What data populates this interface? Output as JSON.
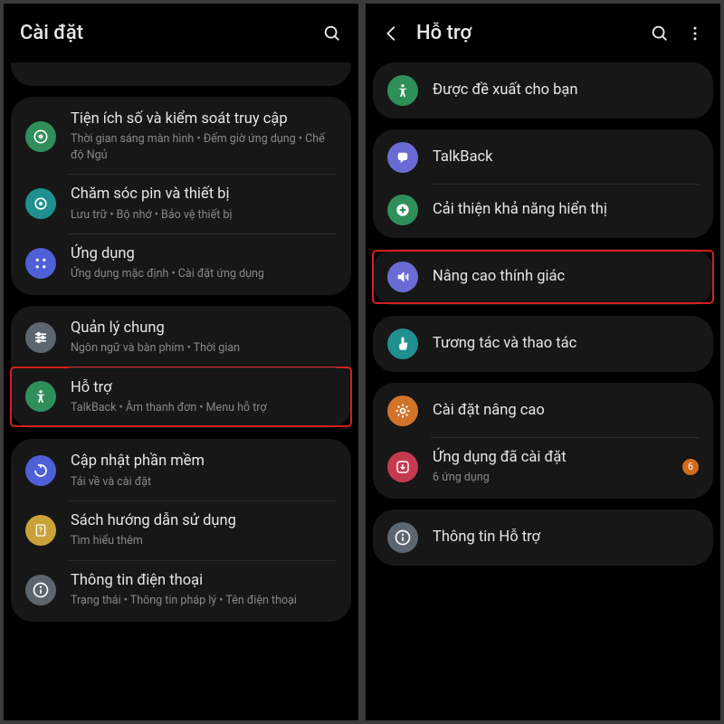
{
  "left": {
    "headerTitle": "Cài đặt",
    "groups": [
      {
        "items": [
          {
            "icon": "wellbeing",
            "color": "#2f8f5a",
            "title": "Tiện ích số và kiểm soát truy cập",
            "sub": "Thời gian sáng màn hình  •  Đếm giờ ứng dụng  •  Chế độ Ngủ"
          },
          {
            "icon": "device-care",
            "color": "#1f8f8f",
            "title": "Chăm sóc pin và thiết bị",
            "sub": "Lưu trữ  •  Bộ nhớ  •  Bảo vệ thiết bị"
          },
          {
            "icon": "apps",
            "color": "#4f5fd6",
            "title": "Ứng dụng",
            "sub": "Ứng dụng mặc định  •  Cài đặt ứng dụng"
          }
        ]
      },
      {
        "items": [
          {
            "icon": "general",
            "color": "#5b6670",
            "title": "Quản lý chung",
            "sub": "Ngôn ngữ và bàn phím  •  Thời gian"
          },
          {
            "icon": "accessibility",
            "color": "#2f8f5a",
            "title": "Hỗ trợ",
            "sub": "TalkBack  •  Âm thanh đơn  •  Menu hỗ trợ",
            "highlighted": true
          }
        ]
      },
      {
        "items": [
          {
            "icon": "update",
            "color": "#4f5fd6",
            "title": "Cập nhật phần mềm",
            "sub": "Tải về và cài đặt"
          },
          {
            "icon": "manual",
            "color": "#caa23a",
            "title": "Sách hướng dẫn sử dụng",
            "sub": "Tìm hiểu thêm"
          },
          {
            "icon": "about",
            "color": "#5b6670",
            "title": "Thông tin điện thoại",
            "sub": "Trạng thái  •  Thông tin pháp lý  •  Tên điện thoại"
          }
        ]
      }
    ]
  },
  "right": {
    "headerTitle": "Hỗ trợ",
    "groups": [
      {
        "items": [
          {
            "icon": "accessibility",
            "color": "#2f8f5a",
            "title": "Được đề xuất cho bạn"
          }
        ]
      },
      {
        "items": [
          {
            "icon": "talkback",
            "color": "#6b6bd6",
            "title": "TalkBack"
          },
          {
            "icon": "visibility",
            "color": "#2f8f5a",
            "title": "Cải thiện khả năng hiển thị"
          }
        ]
      },
      {
        "items": [
          {
            "icon": "hearing",
            "color": "#6b6bd6",
            "title": "Nâng cao thính giác",
            "highlighted": true
          }
        ]
      },
      {
        "items": [
          {
            "icon": "interaction",
            "color": "#1f8f8f",
            "title": "Tương tác và thao tác"
          }
        ]
      },
      {
        "items": [
          {
            "icon": "advanced",
            "color": "#d2732a",
            "title": "Cài đặt nâng cao"
          },
          {
            "icon": "installed",
            "color": "#c53a4f",
            "title": "Ứng dụng đã cài đặt",
            "sub": "6 ứng dụng",
            "badge": "6"
          }
        ]
      },
      {
        "items": [
          {
            "icon": "about",
            "color": "#5b6670",
            "title": "Thông tin Hỗ trợ"
          }
        ]
      }
    ]
  }
}
